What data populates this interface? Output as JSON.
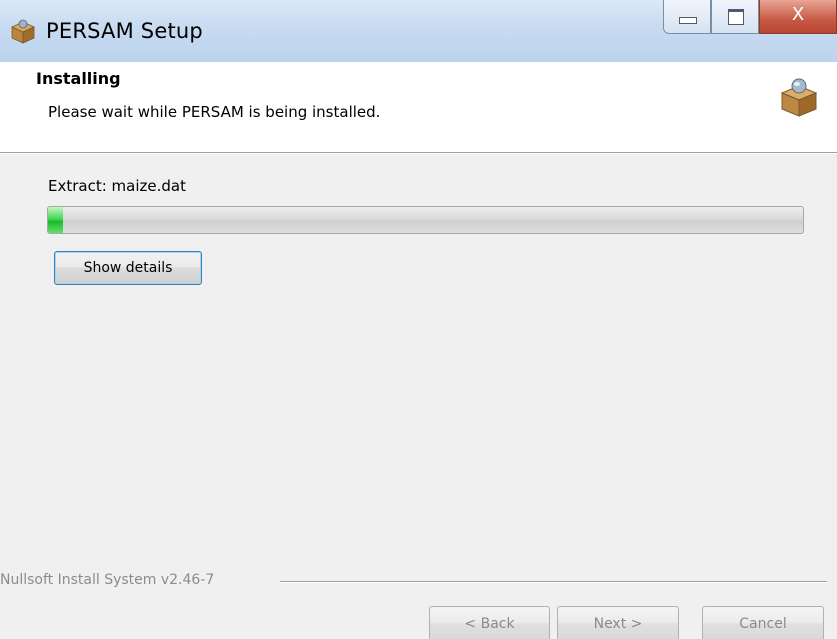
{
  "window": {
    "title": "PERSAM Setup",
    "close_glyph": "X",
    "icons": {
      "app": "installer-box-icon",
      "header": "installer-box-icon"
    }
  },
  "header": {
    "title": "Installing",
    "subtitle": "Please wait while PERSAM is being installed."
  },
  "progress": {
    "status_text": "Extract: maize.dat",
    "value_fraction": 0.02
  },
  "show_details_label": "Show details",
  "footer": {
    "branding": "Nullsoft Install System v2.46-7",
    "back_label": "< Back",
    "next_label": "Next >",
    "cancel_label": "Cancel"
  },
  "colors": {
    "progress_fill": "#37d24a",
    "close_button": "#c75a45",
    "titlebar": "#c7dbf1"
  }
}
